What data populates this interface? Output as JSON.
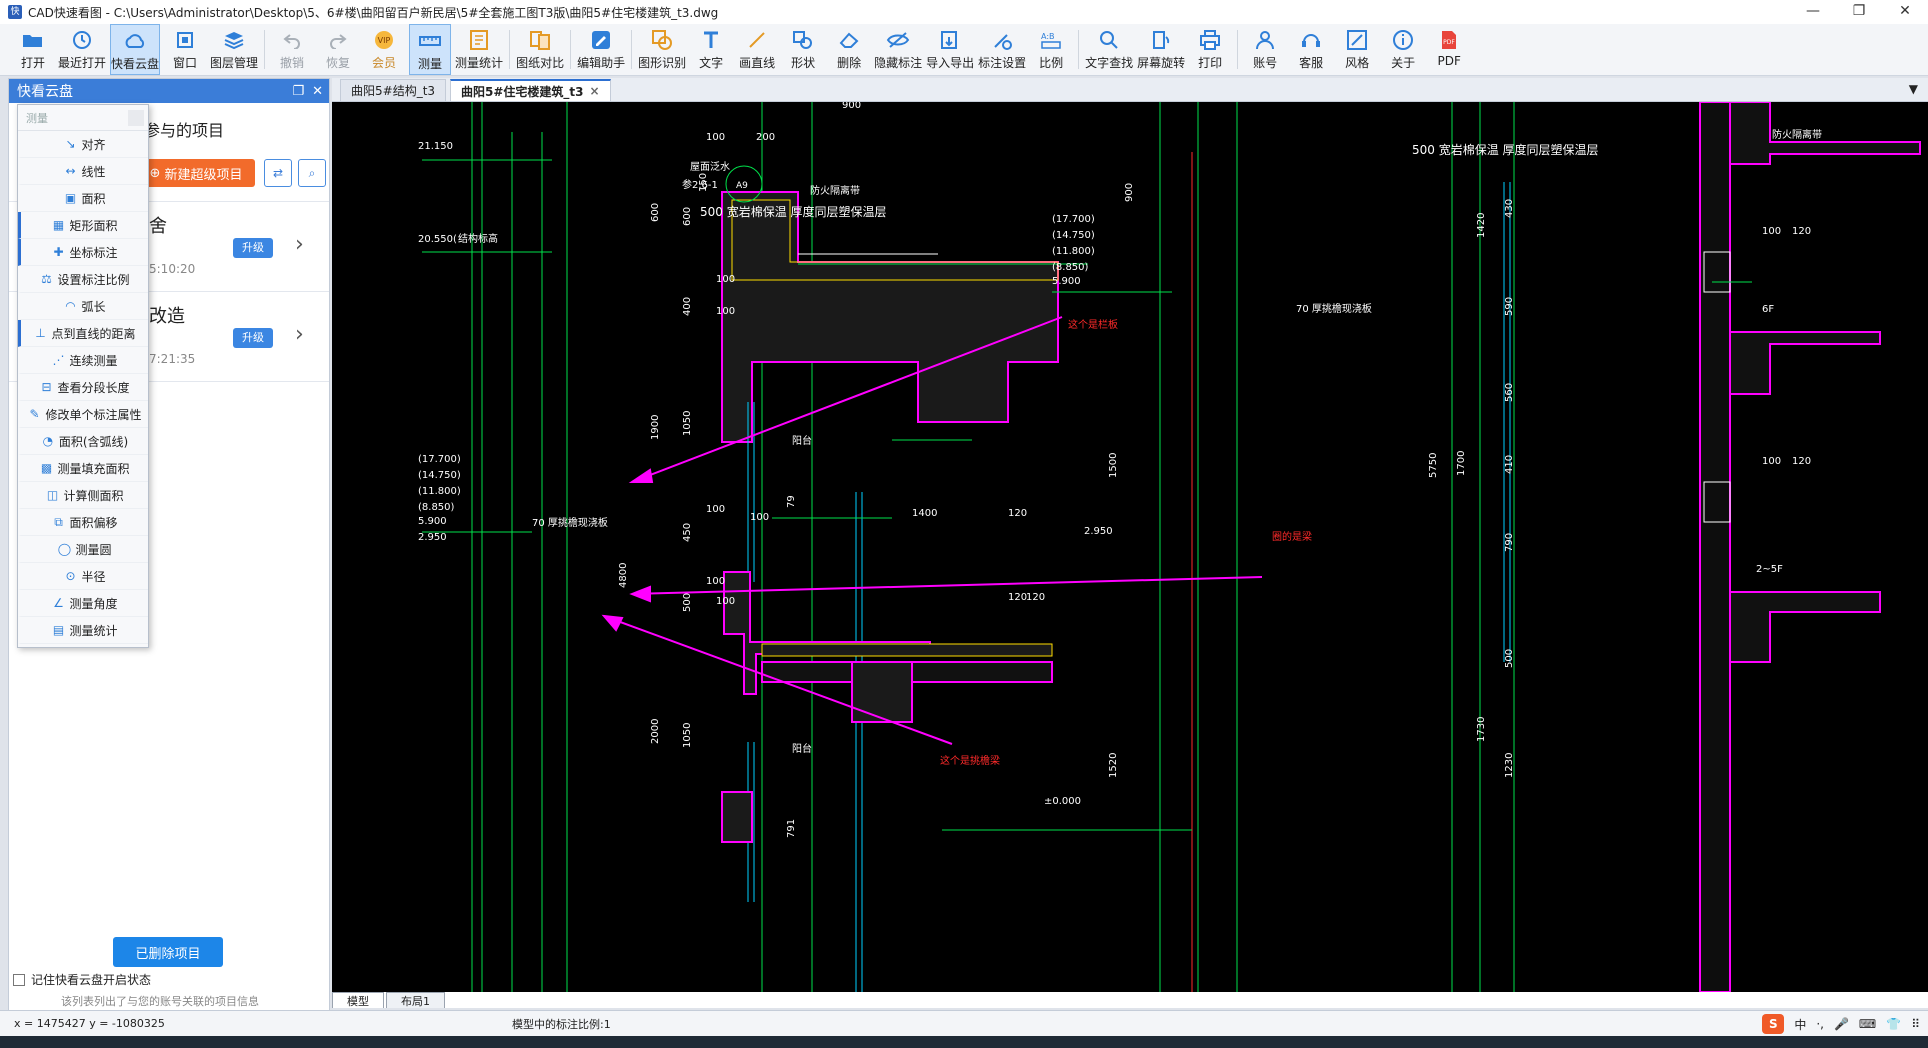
{
  "window": {
    "app_icon_text": "快",
    "title": "CAD快速看图 - C:\\Users\\Administrator\\Desktop\\5、6#楼\\曲阳留百户新民居\\5#全套施工图T3版\\曲阳5#住宅楼建筑_t3.dwg",
    "minimize": "—",
    "maximize": "❐",
    "close": "✕"
  },
  "toolbar": {
    "items": [
      {
        "label": "打开",
        "icon": "open-folder-icon"
      },
      {
        "label": "最近打开",
        "icon": "recent-clock-icon"
      },
      {
        "label": "快看云盘",
        "icon": "cloud-icon"
      },
      {
        "label": "窗口",
        "icon": "window-icon"
      },
      {
        "label": "图层管理",
        "icon": "layers-icon"
      },
      {
        "label": "撤销",
        "icon": "undo-icon"
      },
      {
        "label": "恢复",
        "icon": "redo-icon"
      },
      {
        "label": "会员",
        "icon": "vip-icon"
      },
      {
        "label": "测量",
        "icon": "measure-icon"
      },
      {
        "label": "测量统计",
        "icon": "measure-stats-icon"
      },
      {
        "label": "图纸对比",
        "icon": "compare-icon"
      },
      {
        "label": "编辑助手",
        "icon": "edit-helper-icon"
      },
      {
        "label": "图形识别",
        "icon": "shape-recognition-icon"
      },
      {
        "label": "文字",
        "icon": "text-icon"
      },
      {
        "label": "画直线",
        "icon": "line-icon"
      },
      {
        "label": "形状",
        "icon": "shape-icon"
      },
      {
        "label": "删除",
        "icon": "eraser-icon"
      },
      {
        "label": "隐藏标注",
        "icon": "hide-annotation-icon"
      },
      {
        "label": "导入导出",
        "icon": "import-export-icon"
      },
      {
        "label": "标注设置",
        "icon": "annotation-settings-icon"
      },
      {
        "label": "比例",
        "icon": "scale-icon"
      },
      {
        "label": "文字查找",
        "icon": "text-search-icon"
      },
      {
        "label": "屏幕旋转",
        "icon": "rotate-screen-icon"
      },
      {
        "label": "打印",
        "icon": "print-icon"
      },
      {
        "label": "账号",
        "icon": "account-icon"
      },
      {
        "label": "客服",
        "icon": "headset-icon"
      },
      {
        "label": "风格",
        "icon": "style-icon"
      },
      {
        "label": "关于",
        "icon": "about-icon"
      },
      {
        "label": "PDF",
        "icon": "pdf-icon"
      }
    ]
  },
  "left_panel": {
    "title": "快看云盘",
    "section_title": "参与的项目",
    "new_project_button": "新建超级项目",
    "projects": [
      {
        "name": "舍",
        "time": "5:10:20",
        "badge": "升级"
      },
      {
        "name": "改造",
        "time": "7:21:35",
        "badge": "升级"
      }
    ],
    "deleted_button": "已删除项目",
    "remember_label": "记住快看云盘开启状态",
    "footnote": "该列表列出了与您的账号关联的项目信息"
  },
  "measure_menu": {
    "search_placeholder": "测量",
    "items": [
      {
        "label": "对齐",
        "icon": "align-measure-icon"
      },
      {
        "label": "线性",
        "icon": "linear-measure-icon"
      },
      {
        "label": "面积",
        "icon": "area-icon"
      },
      {
        "label": "矩形面积",
        "icon": "rect-area-icon"
      },
      {
        "label": "坐标标注",
        "icon": "coordinate-icon"
      },
      {
        "label": "设置标注比例",
        "icon": "set-scale-icon"
      },
      {
        "label": "弧长",
        "icon": "arc-length-icon"
      },
      {
        "label": "点到直线的距离",
        "icon": "point-line-distance-icon"
      },
      {
        "label": "连续测量",
        "icon": "continuous-measure-icon"
      },
      {
        "label": "查看分段长度",
        "icon": "segment-length-icon"
      },
      {
        "label": "修改单个标注属性",
        "icon": "edit-annotation-icon"
      },
      {
        "label": "面积(含弧线)",
        "icon": "arc-area-icon"
      },
      {
        "label": "测量填充面积",
        "icon": "fill-area-icon"
      },
      {
        "label": "计算侧面积",
        "icon": "side-area-icon"
      },
      {
        "label": "面积偏移",
        "icon": "area-offset-icon"
      },
      {
        "label": "测量圆",
        "icon": "circle-icon"
      },
      {
        "label": "半径",
        "icon": "radius-icon"
      },
      {
        "label": "测量角度",
        "icon": "angle-icon"
      },
      {
        "label": "测量统计",
        "icon": "measure-stats-icon"
      }
    ]
  },
  "tabs": [
    {
      "label": "曲阳5#结构_t3",
      "active": false
    },
    {
      "label": "曲阳5#住宅楼建筑_t3",
      "active": true,
      "close": "×"
    }
  ],
  "drawing": {
    "labels": {
      "el_21150": "21.150",
      "el_20550": "20.550(",
      "struct_label": "结构标高",
      "roof_water": "屋面泛水",
      "ref_a": "参2.6-1",
      "ref_num": "A9",
      "fire_band": "防火隔离带",
      "insulation": "500 宽岩棉保温  厚度同层塑保温层",
      "elev_list_1": "(17.700)",
      "elev_list_2": "(14.750)",
      "elev_list_3": "(11.800)",
      "elev_list_4": "(8.850)",
      "elev_list_5": "5.900",
      "elev_list_6": "2.950",
      "railing_note": "这个是栏板",
      "balcony_1": "阳台",
      "balcony_2": "阳台",
      "slab_note": "70 厚挑檐现浇板",
      "slab_note_right": "70 厚挑檐现浇板",
      "beam_note": "这个是挑檐梁",
      "elevation_note": "圈的是梁",
      "zero": "±0.000",
      "fire_band_right": "防火隔离带",
      "insulation_right": "500 宽岩棉保温  厚度同层塑保温层",
      "floor_6f": "6F",
      "floor_2_5f": "2~5F",
      "dim_100a": "100",
      "dim_200": "200",
      "dim_150": "150",
      "dim_600a": "600",
      "dim_600b": "600",
      "dim_400": "400",
      "dim_1900": "1900",
      "dim_1050a": "1050",
      "dim_450": "450",
      "dim_500a": "500",
      "dim_4800": "4800",
      "dim_2000": "2000",
      "dim_1050b": "1050",
      "dim_1400": "1400",
      "dim_100b": "100",
      "dim_120a": "120",
      "dim_120b": "120",
      "dim_120c": "120",
      "dim_1500": "1500",
      "dim_1520": "1520",
      "dim_900": "900",
      "dim_1420": "1420",
      "dim_430": "430",
      "dim_590": "590",
      "dim_560": "560",
      "dim_410": "410",
      "dim_790": "790",
      "dim_500b": "500",
      "dim_1230": "1230",
      "dim_1730": "1730",
      "dim_5750": "5750",
      "dim_1700": "1700",
      "dim_100r1": "100",
      "dim_120r1": "120",
      "dim_100r2": "100",
      "dim_120r2": "120",
      "dim_791": "791",
      "dim_100c": "100",
      "dim_100d": "100",
      "dim_100e": "100",
      "dim_100f": "100",
      "dim_100g": "100",
      "dim_900b": "900",
      "dim_790b": "79"
    }
  },
  "layout_tabs": [
    {
      "label": "模型",
      "active": true
    },
    {
      "label": "布局1",
      "active": false
    }
  ],
  "status": {
    "coords": "x = 1475427  y = -1080325",
    "scale_text": "模型中的标注比例:1"
  },
  "ime": {
    "logo": "S",
    "lang": "中",
    "punct": "·,",
    "mic": "🎤",
    "keyboard": "⌨",
    "shirt": "👕",
    "grid": "⠿"
  },
  "colors": {
    "accent": "#3b7dd8",
    "new_button": "#f26b2b",
    "canvas_bg": "#000000",
    "cad_green": "#00e14b",
    "cad_magenta": "#ff00ff",
    "cad_yellow": "#ffdd00",
    "cad_red": "#ff2a2a"
  }
}
